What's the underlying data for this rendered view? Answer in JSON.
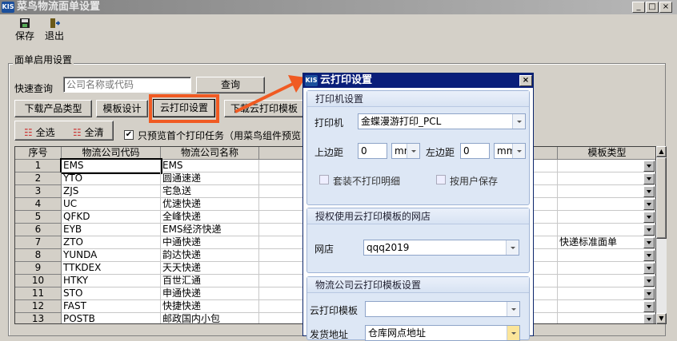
{
  "window": {
    "title": "菜鸟物流面单设置",
    "icon_text": "KIS",
    "min": "_",
    "max": "□",
    "close": "×"
  },
  "toolbar": {
    "save": "保存",
    "exit": "退出"
  },
  "group": {
    "title": "面单启用设置"
  },
  "search": {
    "label": "快速查询",
    "placeholder": "公司名称或代码",
    "button": "查询"
  },
  "buttons": {
    "download_types": "下载产品类型",
    "template_design": "模板设计",
    "cloud_print": "云打印设置",
    "download_cloud": "下载云打印模板",
    "select_all": "全选",
    "clear_all": "全清"
  },
  "preview_option": {
    "label": "只预览首个打印任务（用菜鸟组件预览",
    "checked": true
  },
  "grid": {
    "headers": [
      "序号",
      "物流公司代码",
      "物流公司名称",
      "模板类型"
    ],
    "rows": [
      {
        "n": "1",
        "code": "EMS",
        "name": "EMS",
        "type": ""
      },
      {
        "n": "2",
        "code": "YTO",
        "name": "圆通速递",
        "type": ""
      },
      {
        "n": "3",
        "code": "ZJS",
        "name": "宅急送",
        "type": ""
      },
      {
        "n": "4",
        "code": "UC",
        "name": "优速快递",
        "type": ""
      },
      {
        "n": "5",
        "code": "QFKD",
        "name": "全峰快递",
        "type": ""
      },
      {
        "n": "6",
        "code": "EYB",
        "name": "EMS经济快递",
        "type": ""
      },
      {
        "n": "7",
        "code": "ZTO",
        "name": "中通快递",
        "type": "快递标准面单"
      },
      {
        "n": "8",
        "code": "YUNDA",
        "name": "韵达快递",
        "type": ""
      },
      {
        "n": "9",
        "code": "TTKDEX",
        "name": "天天快递",
        "type": ""
      },
      {
        "n": "10",
        "code": "HTKY",
        "name": "百世汇通",
        "type": ""
      },
      {
        "n": "11",
        "code": "STO",
        "name": "申通快递",
        "type": ""
      },
      {
        "n": "12",
        "code": "FAST",
        "name": "快捷快递",
        "type": ""
      },
      {
        "n": "13",
        "code": "POSTB",
        "name": "邮政国内小包",
        "type": ""
      }
    ]
  },
  "dialog": {
    "title": "云打印设置",
    "icon_text": "KIS",
    "close": "×",
    "printer_section": "打印机设置",
    "printer_label": "打印机",
    "printer_value": "金蝶漫游打印_PCL",
    "top_margin_label": "上边距",
    "top_margin": "0",
    "top_unit": "mm",
    "left_margin_label": "左边距",
    "left_margin": "0",
    "left_unit": "mm",
    "no_detail": "套装不打印明细",
    "by_user": "按用户保存",
    "shop_section": "授权使用云打印模板的网店",
    "shop_label": "网店",
    "shop_value": "qqq2019",
    "tpl_section": "物流公司云打印模板设置",
    "tpl_label": "云打印模板",
    "tpl_value": "",
    "addr_label": "发货地址",
    "addr_value": "仓库网点地址"
  },
  "colors": {
    "highlight": "#f05a22",
    "dialog_title": "#0a1e7a"
  }
}
